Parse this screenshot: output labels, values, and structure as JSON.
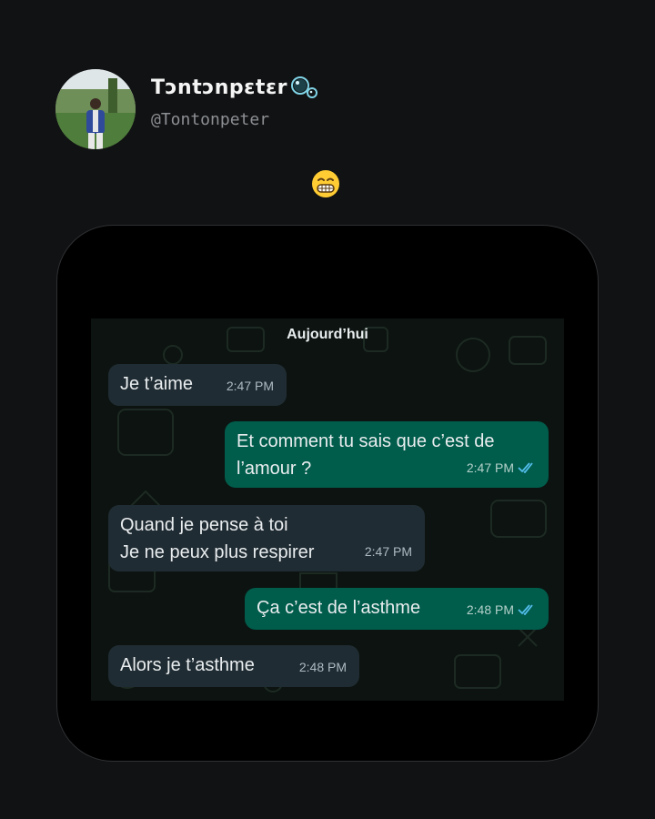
{
  "post": {
    "display_name": "Tɔntɔnpɛtɛr",
    "handle": "@Tontonpeter",
    "name_icon": "bubbles-icon",
    "caption_emoji": "grinning-face-with-smiling-eyes"
  },
  "chat": {
    "date_label": "Aujourd’hui",
    "messages": [
      {
        "direction": "incoming",
        "text": "Je t’aime",
        "time": "2:47 PM"
      },
      {
        "direction": "outgoing",
        "text": "Et comment tu sais que c’est de\nl’amour ?",
        "time": "2:47 PM",
        "status": "read"
      },
      {
        "direction": "incoming",
        "text": "Quand je pense à toi\nJe ne peux plus respirer",
        "time": "2:47 PM"
      },
      {
        "direction": "outgoing",
        "text": "Ça c’est de l’asthme",
        "time": "2:48 PM",
        "status": "read"
      },
      {
        "direction": "incoming",
        "text": "Alors je t’asthme",
        "time": "2:48 PM"
      }
    ]
  },
  "colors": {
    "background": "#111213",
    "incoming_bubble": "#202c33",
    "outgoing_bubble": "#005c4b",
    "read_tick": "#53bdeb"
  }
}
